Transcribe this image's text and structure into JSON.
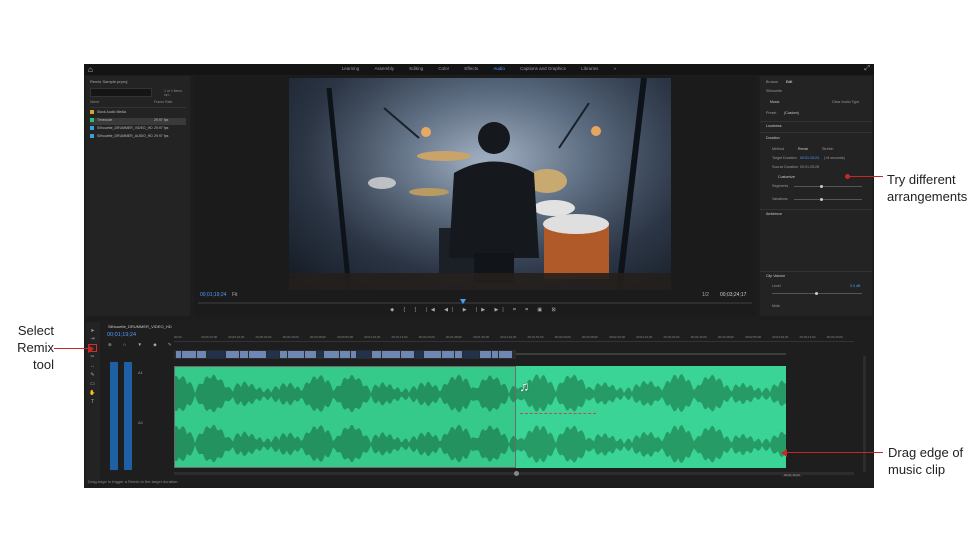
{
  "workspaces": {
    "items": [
      "Learning",
      "Assembly",
      "Editing",
      "Color",
      "Effects",
      "Audio",
      "Captions and Graphics",
      "Libraries"
    ],
    "active_index": 5,
    "more": "»"
  },
  "project_panel": {
    "title": "Remix Sample.prproj",
    "search_placeholder": "",
    "item_count": "1 of 4 items sel...",
    "column_name": "Name",
    "column_fps": "Frame Rate",
    "rows": [
      {
        "name": "Stock Audio Media",
        "fps": "",
        "color": "#e0a030"
      },
      {
        "name": "Timecode",
        "fps": "29.97 fps",
        "color": "#2fbf74"
      },
      {
        "name": "Silhouette_DRUMMER_VIDEO_HD",
        "fps": "29.97 fps",
        "color": "#3aa0d8"
      },
      {
        "name": "Silhouette_DRUMMER_AUDIO_HD",
        "fps": "29.97 fps",
        "color": "#3aa0d8"
      }
    ]
  },
  "program": {
    "timecode_left": "00;01;19;24",
    "fit": "Fit",
    "quality": "1/2",
    "timecode_right": "00;03;24;17",
    "transport": "◆ { } |◀ ◀| ▶ |▶ ▶| ⌗ ⌗ ▣ ⊠"
  },
  "essential_sound": {
    "tab_browse": "Browse",
    "tab_edit": "Edit",
    "clip_label": "Silhouette",
    "type": "Music",
    "clear_type": "Clear Audio Type",
    "preset_label": "Preset",
    "preset_value": "(Custom)",
    "loudness": "Loudness",
    "duration": "Duration",
    "method_label": "Method",
    "method_remix": "Remix",
    "method_stretch": "Stretch",
    "target_label": "Target Duration",
    "target_value": "00:01:19:24",
    "target_note": "(+8 seconds)",
    "source_label": "Source Duration",
    "source_value": "00:01:25:28",
    "customize": "Customize",
    "segments_label": "Segments",
    "variations_label": "Variations",
    "ambience": "Ambience",
    "clip_volume": "Clip Volume",
    "level_label": "Level",
    "level_value": "0.0 dB",
    "mute_label": "Mute"
  },
  "timeline": {
    "sequence_tab": "Silhouette_DRUMMER_VIDEO_HD",
    "timecode": "00;01;19;24",
    "ruler_labels": [
      "00;00",
      "00;00;16;00",
      "00;00;24;00",
      "00;00;32;00",
      "00;00;40;00",
      "00;00;48;00",
      "00;00;56;00",
      "00;01;04;00",
      "00;01;12;00",
      "00;01;20;00",
      "00;01;28;00",
      "00;01;36;00",
      "00;01;44;00",
      "00;01;52;00",
      "00;02;00;00",
      "00;02;08;00",
      "00;02;16;00",
      "00;02;24;00",
      "00;02;32;00",
      "00;02;40;00",
      "00;02;48;00",
      "00;02;56;00",
      "00;03;04;00",
      "00;03;12;00",
      "00;03;20;00"
    ],
    "track_tools": "⊕ ∩ ▼ ◆ ✎",
    "track_a1": "A1",
    "track_a2": "A2",
    "end_timecode": "00;01;19;24",
    "status_text": "Drag edge to trigger a Remix to the target duration."
  },
  "annotations": {
    "try": "Try different\narrangements",
    "select": "Select\nRemix\ntool",
    "drag": "Drag edge of\nmusic clip"
  },
  "colors": {
    "accent": "#4d9dff",
    "audio_clip": "#35c98a",
    "video_clip": "#6e87b3",
    "callout_line": "#c62828"
  }
}
